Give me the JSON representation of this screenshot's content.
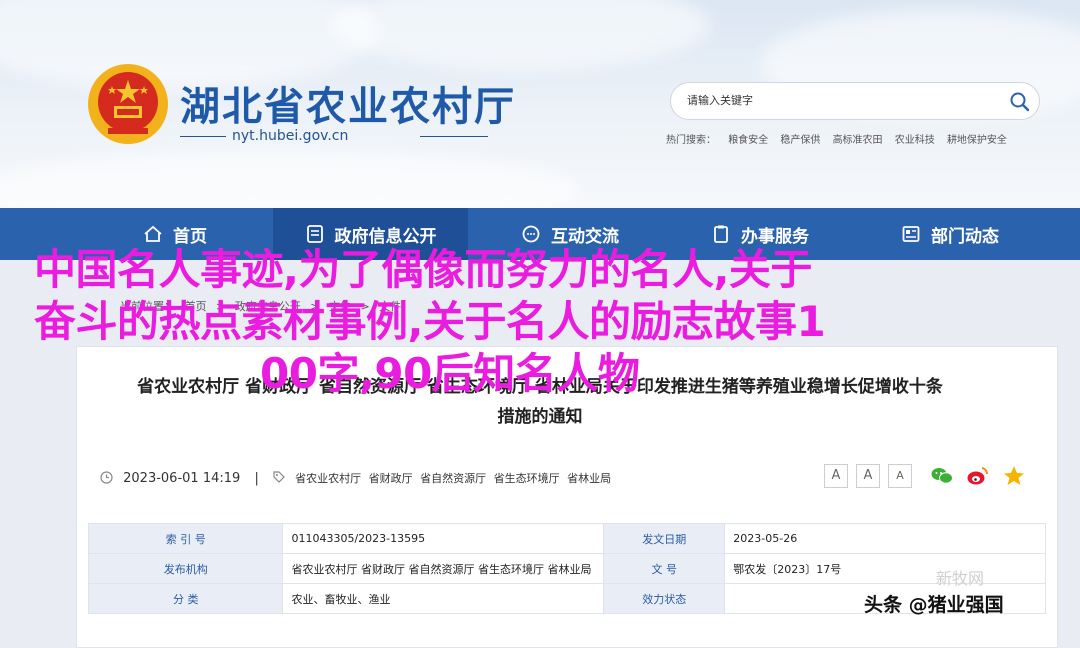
{
  "header": {
    "site_title": "湖北省农业农村厅",
    "site_url": "nyt.hubei.gov.cn",
    "search_placeholder": "请输入关键字",
    "hot_label": "热门搜索：",
    "hot_items": [
      "粮食安全",
      "稳产保供",
      "高标准农田",
      "农业科技",
      "耕地保护安全"
    ]
  },
  "nav": {
    "items": [
      {
        "label": "首页",
        "icon": "home-icon"
      },
      {
        "label": "政府信息公开",
        "icon": "document-icon"
      },
      {
        "label": "互动交流",
        "icon": "chat-icon"
      },
      {
        "label": "办事服务",
        "icon": "clipboard-icon"
      },
      {
        "label": "部门动态",
        "icon": "news-icon"
      }
    ]
  },
  "breadcrumb": [
    "当前位置：",
    "首页",
    ">",
    "政府信息公开",
    ">",
    "文件",
    ">",
    "文件"
  ],
  "document": {
    "title_line1": "省农业农村厅 省财政厅 省自然资源厅 省生态环境厅 省林业局关于印发推进生猪等养殖业稳增长促增收十条",
    "title_line2": "措施的通知",
    "date": "2023-06-01 14:19",
    "sep": "|",
    "issuers": [
      "省农业农村厅",
      "省财政厅",
      "省自然资源厅",
      "省生态环境厅",
      "省林业局"
    ],
    "font_buttons": [
      "A",
      "A",
      "A"
    ]
  },
  "info_table": {
    "rows": [
      {
        "label1": "索 引 号",
        "value1": "011043305/2023-13595",
        "label2": "发文日期",
        "value2": "2023-05-26"
      },
      {
        "label1": "发布机构",
        "value1": "省农业农村厅 省财政厅 省自然资源厅 省生态环境厅 省林业局",
        "label2": "文 号",
        "value2": "鄂农发〔2023〕17号"
      },
      {
        "label1": "分 类",
        "value1": "农业、畜牧业、渔业",
        "label2": "效力状态",
        "value2": ""
      }
    ]
  },
  "overlay": {
    "line1": "中国名人事迹,为了偶像而努力的名人,关于",
    "line2": "奋斗的热点素材事例,关于名人的励志故事1",
    "line3": "00字,90后知名人物"
  },
  "watermark": "新牧网",
  "source_tag": "头条 @猪业强国",
  "colors": {
    "brand_blue": "#2a62ae",
    "overlay_magenta": "#ea1ce0"
  }
}
